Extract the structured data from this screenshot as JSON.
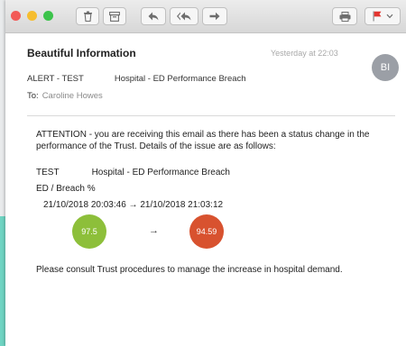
{
  "toolbar": {
    "icons": [
      "trash-icon",
      "archive-icon",
      "reply-icon",
      "reply-all-icon",
      "forward-icon",
      "print-icon",
      "flag-icon",
      "chevron-down-icon"
    ],
    "flag_color": "#e3342f"
  },
  "email": {
    "sender": "Beautiful Information",
    "timestamp": "Yesterday at 22:03",
    "avatar_initials": "BI",
    "subject_prefix": "ALERT - TEST",
    "subject_suffix": "Hospital - ED Performance Breach",
    "to_label": "To:",
    "to_name": "Caroline Howes"
  },
  "body": {
    "attention": "ATTENTION - you are receiving this email as there has been a status change in the performance of the Trust. Details of the issue are as follows:",
    "test_label": "TEST",
    "test_detail": "Hospital - ED Performance Breach",
    "metric": "ED / Breach %",
    "date_from": "21/10/2018 20:03:46",
    "arrow": "→",
    "date_to": "21/10/2018 21:03:12",
    "value_from": "97.5",
    "value_to": "94.59",
    "value_from_color": "#8dbf3a",
    "value_to_color": "#d8522f",
    "footer": "Please consult Trust procedures to manage the increase in hospital demand."
  }
}
